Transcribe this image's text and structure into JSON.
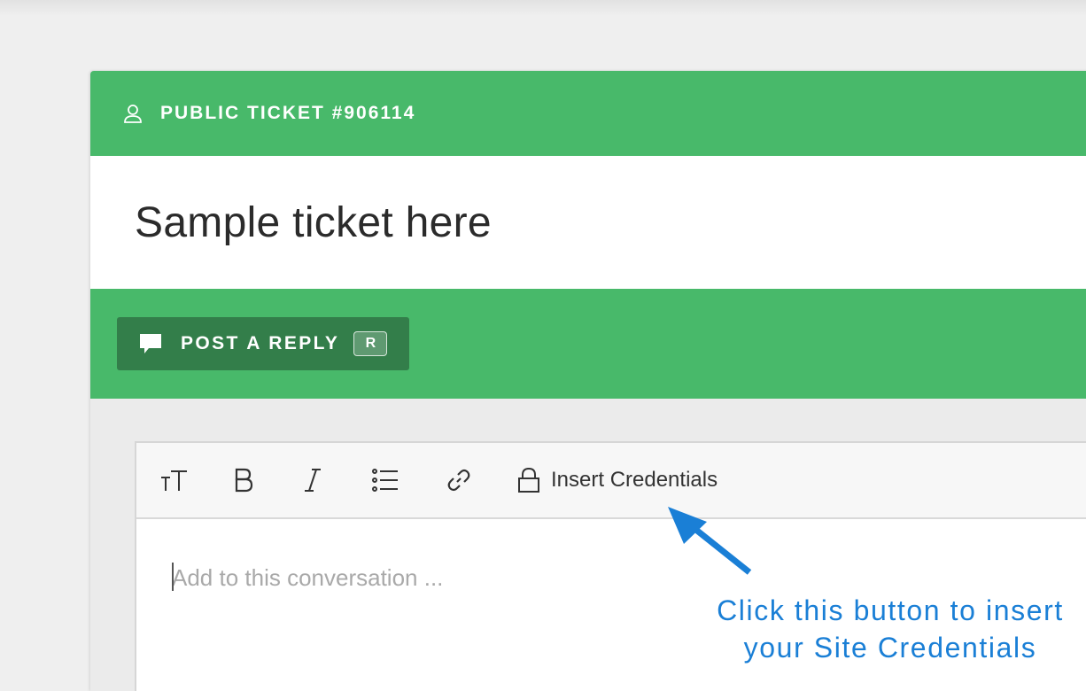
{
  "ticket": {
    "label": "PUBLIC TICKET #906114",
    "title": "Sample ticket here"
  },
  "reply": {
    "label": "POST A REPLY",
    "shortcut": "R"
  },
  "editor": {
    "toolbar": {
      "tools": [
        "text-size-icon",
        "bold-icon",
        "italic-icon",
        "list-icon",
        "link-icon",
        "lock-icon"
      ],
      "credentials_label": "Insert Credentials"
    },
    "placeholder": "Add to this conversation ..."
  },
  "annotation": {
    "line1": "Click this button to insert",
    "line2": "your Site Credentials"
  },
  "colors": {
    "accent_green": "#48b96a",
    "button_green": "#337e4a",
    "annotation_blue": "#1a7fd6"
  }
}
